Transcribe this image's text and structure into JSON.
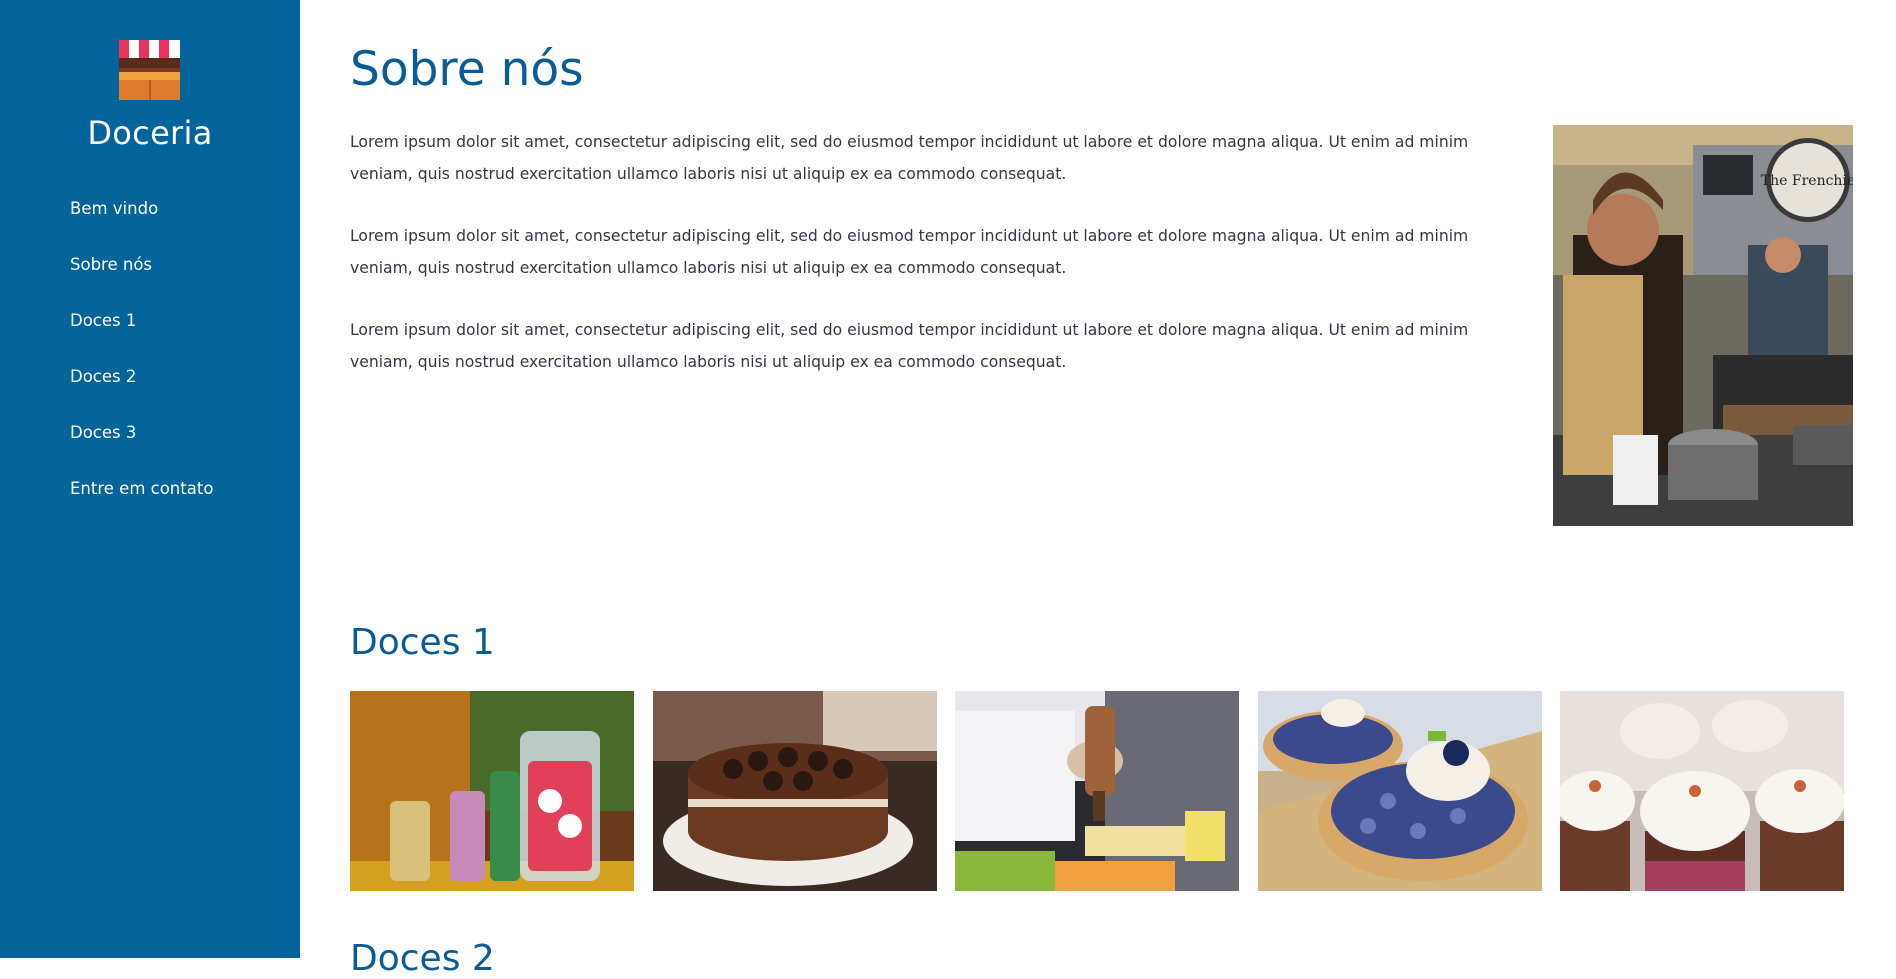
{
  "sidebar": {
    "brand": "Doceria",
    "nav": [
      {
        "label": "Bem vindo"
      },
      {
        "label": "Sobre nós"
      },
      {
        "label": "Doces 1"
      },
      {
        "label": "Doces 2"
      },
      {
        "label": "Doces 3"
      },
      {
        "label": "Entre em contato"
      }
    ]
  },
  "about": {
    "title": "Sobre nós",
    "paragraphs": [
      "Lorem ipsum dolor sit amet, consectetur adipiscing elit, sed do eiusmod tempor incididunt ut labore et dolore magna aliqua. Ut enim ad minim veniam, quis nostrud exercitation ullamco laboris nisi ut aliquip ex ea commodo consequat.",
      "Lorem ipsum dolor sit amet, consectetur adipiscing elit, sed do eiusmod tempor incididunt ut labore et dolore magna aliqua. Ut enim ad minim veniam, quis nostrud exercitation ullamco laboris nisi ut aliquip ex ea commodo consequat.",
      "Lorem ipsum dolor sit amet, consectetur adipiscing elit, sed do eiusmod tempor incididunt ut labore et dolore magna aliqua. Ut enim ad minim veniam, quis nostrud exercitation ullamco laboris nisi ut aliquip ex ea commodo consequat."
    ],
    "photo_sign": "The Frenchie"
  },
  "doces1": {
    "title": "Doces 1"
  },
  "doces2": {
    "title": "Doces 2"
  },
  "colors": {
    "sidebar": "#02649a",
    "heading": "#0b5c96",
    "text": "#333845"
  }
}
